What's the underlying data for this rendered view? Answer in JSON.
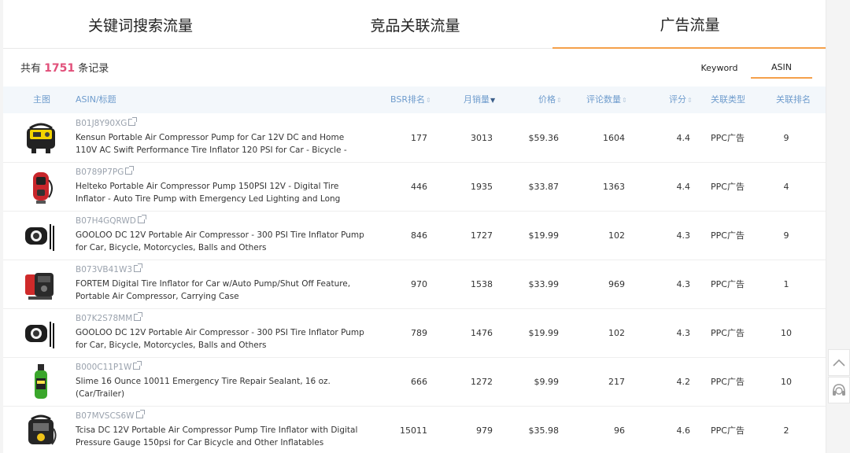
{
  "tabs": [
    "关键词搜索流量",
    "竞品关联流量",
    "广告流量"
  ],
  "record_count": {
    "prefix": "共有",
    "count": "1751",
    "suffix": "条记录"
  },
  "sub_tabs": [
    "Keyword",
    "ASIN"
  ],
  "columns": {
    "image": "主图",
    "asin_title": "ASIN/标题",
    "bsr": "BSR排名",
    "monthly_sales": "月销量",
    "price": "价格",
    "reviews": "评论数量",
    "rating": "评分",
    "link_type": "关联类型",
    "link_rank": "关联排名"
  },
  "rows": [
    {
      "asin": "B01J8Y90XG",
      "title": "Kensun Portable Air Compressor Pump for Car 12V DC and Home 110V AC Swift Performance Tire Inflator 120 PSI for Car - Bicycle - Motorcy...",
      "bsr": "177",
      "sales": "3013",
      "price": "$59.36",
      "reviews": "1604",
      "rating": "4.4",
      "type": "PPC广告",
      "rank": "9",
      "image": "kensun-compressor"
    },
    {
      "asin": "B0789P7PG",
      "title": "Helteko Portable Air Compressor Pump 150PSI 12V - Digital Tire Inflator - Auto Tire Pump with Emergency Led Lighting and Long Cable for C...",
      "bsr": "446",
      "sales": "1935",
      "price": "$33.87",
      "reviews": "1363",
      "rating": "4.4",
      "type": "PPC广告",
      "rank": "4",
      "image": "helteko-pump"
    },
    {
      "asin": "B07H4GQRWD",
      "title": "GOOLOO DC 12V Portable Air Compressor - 300 PSI Tire Inflator Pump for Car, Bicycle, Motorcycles, Balls and Others",
      "bsr": "846",
      "sales": "1727",
      "price": "$19.99",
      "reviews": "102",
      "rating": "4.3",
      "type": "PPC广告",
      "rank": "9",
      "image": "gooloo-compressor"
    },
    {
      "asin": "B073VB41W3",
      "title": "FORTEM Digital Tire Inflator for Car w/Auto Pump/Shut Off Feature, Portable Air Compressor, Carrying Case",
      "bsr": "970",
      "sales": "1538",
      "price": "$33.99",
      "reviews": "969",
      "rating": "4.3",
      "type": "PPC广告",
      "rank": "1",
      "image": "fortem-inflator"
    },
    {
      "asin": "B07K2S78MM",
      "title": "GOOLOO DC 12V Portable Air Compressor - 300 PSI Tire Inflator Pump for Car, Bicycle, Motorcycles, Balls and Others",
      "bsr": "789",
      "sales": "1476",
      "price": "$19.99",
      "reviews": "102",
      "rating": "4.3",
      "type": "PPC广告",
      "rank": "10",
      "image": "gooloo-compressor"
    },
    {
      "asin": "B000C11P1W",
      "title": "Slime 16 Ounce 10011 Emergency Tire Repair Sealant, 16 oz. (Car/Trailer)",
      "bsr": "666",
      "sales": "1272",
      "price": "$9.99",
      "reviews": "217",
      "rating": "4.2",
      "type": "PPC广告",
      "rank": "10",
      "image": "slime-sealant"
    },
    {
      "asin": "B07MVSCS6W",
      "title": "Tcisa DC 12V Portable Air Compressor Pump Tire Inflator with Digital Pressure Gauge 150psi for Car Bicycle and Other Inflatables",
      "bsr": "15011",
      "sales": "979",
      "price": "$35.98",
      "reviews": "96",
      "rating": "4.6",
      "type": "PPC广告",
      "rank": "2",
      "image": "tcisa-compressor"
    }
  ],
  "colors": {
    "accent": "#f5a04a",
    "count": "#e1507a",
    "header_text": "#6f9ccd",
    "header_bg": "#f3f7fb"
  },
  "side_buttons": [
    "chevron-up-icon",
    "support-headset-icon"
  ]
}
